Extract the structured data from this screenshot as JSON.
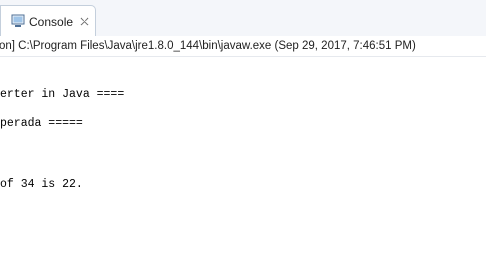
{
  "tab": {
    "icon": "console-icon",
    "label": "Console",
    "close_icon": "close-icon"
  },
  "launch": {
    "text": "on] C:\\Program Files\\Java\\jre1.8.0_144\\bin\\javaw.exe (Sep 29, 2017, 7:46:51 PM)"
  },
  "output": {
    "lines": [
      "erter in Java ====",
      "perada =====",
      "of 34 is 22."
    ]
  }
}
